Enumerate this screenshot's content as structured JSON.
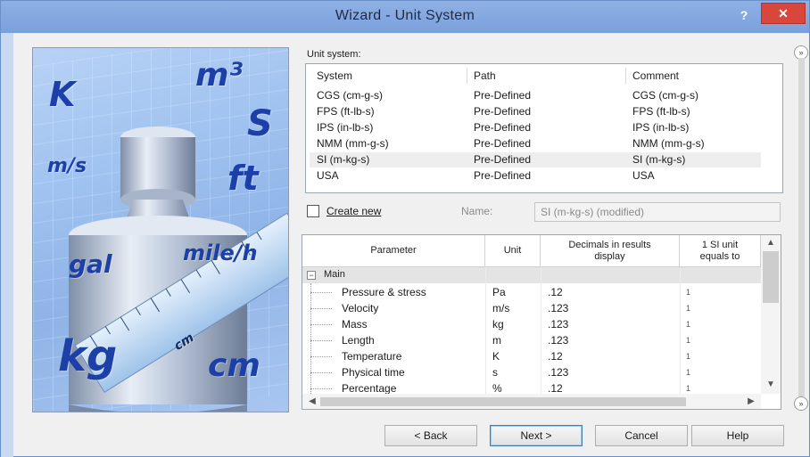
{
  "window": {
    "title": "Wizard - Unit System",
    "help_label": "?",
    "close_label": "✕"
  },
  "picture": {
    "words": [
      "K",
      "m³",
      "S",
      "m/s",
      "ft",
      "gal",
      "mile/h",
      "kg",
      "cm",
      "cm"
    ]
  },
  "unit_system": {
    "label": "Unit system:",
    "columns": [
      "System",
      "Path",
      "Comment"
    ],
    "rows": [
      {
        "system": "CGS (cm-g-s)",
        "path": "Pre-Defined",
        "comment": "CGS (cm-g-s)"
      },
      {
        "system": "FPS (ft-lb-s)",
        "path": "Pre-Defined",
        "comment": "FPS (ft-lb-s)"
      },
      {
        "system": "IPS (in-lb-s)",
        "path": "Pre-Defined",
        "comment": "IPS (in-lb-s)"
      },
      {
        "system": "NMM (mm-g-s)",
        "path": "Pre-Defined",
        "comment": "NMM (mm-g-s)"
      },
      {
        "system": "SI (m-kg-s)",
        "path": "Pre-Defined",
        "comment": "SI (m-kg-s)"
      },
      {
        "system": "USA",
        "path": "Pre-Defined",
        "comment": "USA"
      }
    ],
    "selected_index": 4
  },
  "create_new": {
    "label": "Create new",
    "checked": false
  },
  "name_field": {
    "label": "Name:",
    "value": "SI (m-kg-s) (modified)"
  },
  "parameters": {
    "columns": [
      "Parameter",
      "Unit",
      "Decimals in results display",
      "1 SI unit equals to"
    ],
    "group": {
      "label": "Main",
      "toggle": "−"
    },
    "rows": [
      {
        "parameter": "Pressure & stress",
        "unit": "Pa",
        "decimals": ".12",
        "si": "1"
      },
      {
        "parameter": "Velocity",
        "unit": "m/s",
        "decimals": ".123",
        "si": "1"
      },
      {
        "parameter": "Mass",
        "unit": "kg",
        "decimals": ".123",
        "si": "1"
      },
      {
        "parameter": "Length",
        "unit": "m",
        "decimals": ".123",
        "si": "1"
      },
      {
        "parameter": "Temperature",
        "unit": "K",
        "decimals": ".12",
        "si": "1"
      },
      {
        "parameter": "Physical time",
        "unit": "s",
        "decimals": ".123",
        "si": "1"
      },
      {
        "parameter": "Percentage",
        "unit": "%",
        "decimals": ".12",
        "si": "1"
      }
    ],
    "scroll_up": "▲",
    "scroll_down": "▼",
    "scroll_left": "◀",
    "scroll_right": "▶"
  },
  "side_scroll": {
    "top": "»",
    "bottom": "»"
  },
  "buttons": {
    "back": "< Back",
    "next": "Next >",
    "cancel": "Cancel",
    "help": "Help"
  },
  "colors": {
    "titlebar": "#8fb0e4",
    "close": "#d9463b",
    "picture_text": "#1d3fa8"
  }
}
